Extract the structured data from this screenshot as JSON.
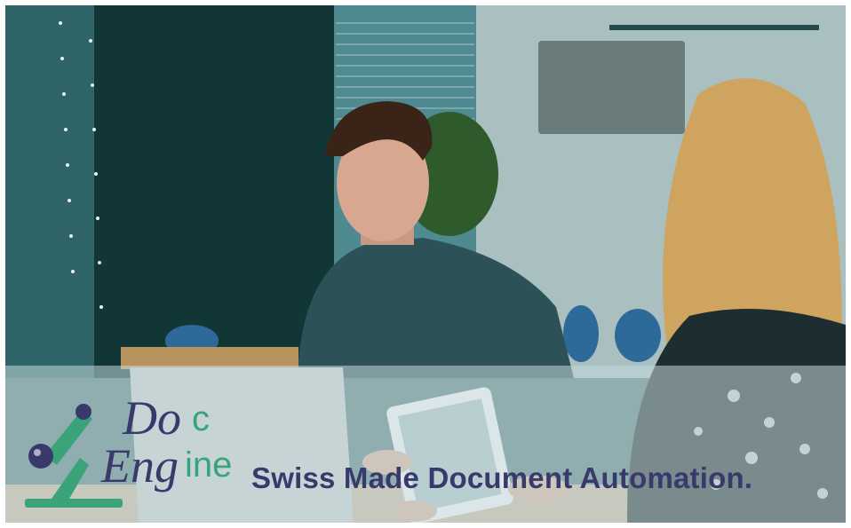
{
  "banner": {
    "tagline": "Swiss Made Document Automation.",
    "colors": {
      "navy": "#383a6b",
      "green": "#3aa37a",
      "overlay": "#c4d8da"
    }
  },
  "logo": {
    "line1_dark": "Do",
    "line1_green": "c",
    "line2_dark": "Eng",
    "line2_green": "ine",
    "icon": "microscope-icon"
  },
  "photo": {
    "scene": "office-meeting-image"
  }
}
